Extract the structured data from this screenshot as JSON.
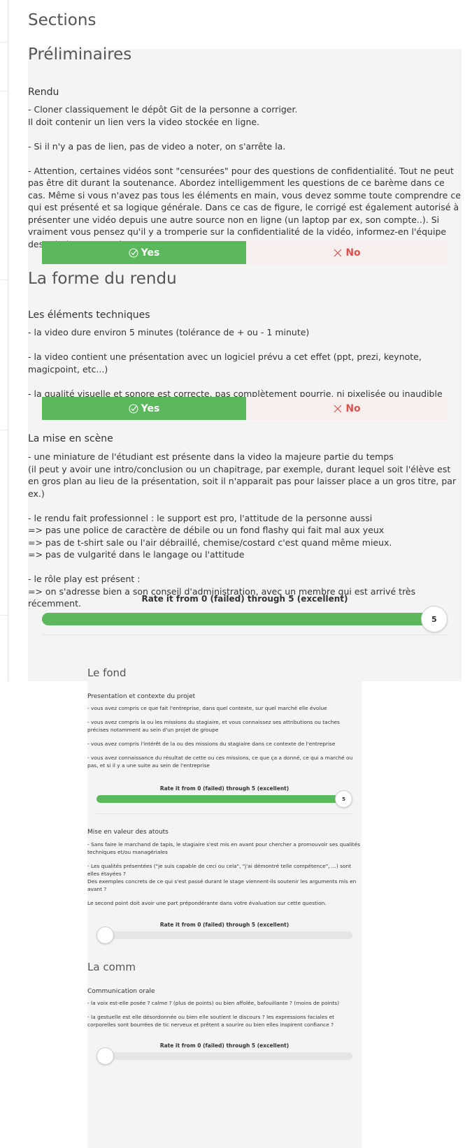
{
  "page": {
    "heading": "Sections"
  },
  "sections": {
    "preliminaires": {
      "title": "Préliminaires",
      "rendu": {
        "title": "Rendu",
        "paragraphs": [
          [
            "- Cloner classiquement le dépôt Git de la personne a corriger.",
            "Il doit contenir un lien vers la video stockée en ligne."
          ],
          [
            "- Si il n'y a pas de lien, pas de video a noter, on s'arrête la."
          ],
          [
            "- Attention, certaines vidéos sont \"censurées\" pour des questions de confidentialité. Tout ne peut pas être dit durant la soutenance. Abordez intelligemment les questions de ce barème dans ce cas. Même si vous n'avez pas tous les éléments en main, vous devez somme toute comprendre ce qui est présenté et sa logique générale. Dans ce cas de figure, le corrigé est également autorisé à présenter une vidéo depuis une autre source non en ligne (un laptop par ex, son compte..). Si vraiment vous pensez qu'il y a tromperie sur la confidentialité de la vidéo, informez-en l'équipe des relations entreprises."
          ]
        ],
        "yes_label": "Yes",
        "no_label": "No"
      }
    },
    "forme": {
      "title": "La forme du rendu",
      "techniques": {
        "title": "Les éléments techniques",
        "paragraphs": [
          [
            "- la video dure environ 5 minutes (tolérance de + ou - 1 minute)"
          ],
          [
            "- la video contient une présentation avec un logiciel prévu a cet effet (ppt, prezi, keynote, magicpoint, etc...)"
          ],
          [
            "- la qualité visuelle et sonore est correcte, pas complètement pourrie, ni pixelisée ou inaudible"
          ]
        ],
        "yes_label": "Yes",
        "no_label": "No"
      },
      "mise_en_scene": {
        "title": "La mise en scène",
        "paragraphs": [
          [
            "- une miniature de l'étudiant est présente dans la video la majeure partie du temps",
            "(il peut y avoir une intro/conclusion ou un chapitrage, par exemple, durant lequel soit l'élève est en gros plan au lieu de la présentation, soit il n'apparait pas pour laisser place a un gros titre, par ex.)"
          ],
          [
            "- le rendu fait professionnel : le support est pro, l'attitude de la personne aussi",
            "=> pas une police de caractère de débile ou un fond flashy qui fait mal aux yeux",
            "=> pas de t-shirt sale ou l'air débraillé, chemise/costard c'est quand même mieux.",
            "=> pas de vulgarité dans le langage ou l'attitude"
          ],
          [
            "- le rôle play est présent :",
            "=> on s'adresse bien a son conseil d'administration, avec un membre qui est arrivé très récemment."
          ]
        ],
        "rate_label": "Rate it from 0 (failed) through 5 (excellent)",
        "rating": 5,
        "rating_max": 5,
        "rating_text": "5"
      }
    },
    "fond": {
      "title": "Le fond",
      "presentation": {
        "title": "Presentation et contexte du projet",
        "paragraphs": [
          [
            "- vous avez compris ce que fait l'entreprise, dans quel contexte, sur quel marché elle évolue"
          ],
          [
            "- vous avez compris la ou les missions du stagiaire, et vous connaissez ses attributions ou taches précises notamment au sein d'un projet de groupe"
          ],
          [
            "- vous avez compris l'intérêt de la ou des missions du stagiaire dans ce contexte de l'entreprise"
          ],
          [
            "- vous avez connaissance du résultat de cette ou ces missions, ce que ça a donné, ce qui a marché ou pas, et si il y a une suite au sein de l'entreprise"
          ]
        ],
        "rate_label": "Rate it from 0 (failed) through 5 (excellent)",
        "rating": 5,
        "rating_max": 5,
        "rating_text": "5"
      },
      "atouts": {
        "title": "Mise en valeur des atouts",
        "paragraphs": [
          [
            "- Sans faire le marchand de tapis, le stagiaire s'est mis en avant pour chercher a promouvoir ses qualités techniques et/ou managériales"
          ],
          [
            "- Les qualités présentées (\"je suis capable de ceci ou cela\", \"j'ai démontré telle compétence\", ...) sont elles étayées ?",
            "Des exemples concrets de ce qui s'est passé durant le stage viennent-ils soutenir les arguments mis en avant ?"
          ],
          [
            "Le second point doit avoir une part prépondérante dans votre évaluation sur cette question."
          ]
        ],
        "rate_label": "Rate it from 0 (failed) through 5 (excellent)",
        "rating": 0,
        "rating_max": 5,
        "rating_text": ""
      }
    },
    "comm": {
      "title": "La comm",
      "orale": {
        "title": "Communication orale",
        "paragraphs": [
          [
            "- la voix est-elle posée ? calme ? (plus de points) ou bien affolée, bafouillante ? (moins de points)"
          ],
          [
            "- la gestuelle est elle désordonnée ou bien elle soutient le discours ? les expressions faciales et corporelles sont bourrées de tic nerveux et prêtent a sourire ou bien elles inspirent confiance ?"
          ]
        ],
        "rate_label": "Rate it from 0 (failed) through 5 (excellent)",
        "rating": 0,
        "rating_max": 5,
        "rating_text": ""
      }
    }
  },
  "colors": {
    "yes": "#5cb85c",
    "no": "#d9534f",
    "panel": "#f4f4f4"
  },
  "icons": {
    "yes": "check-icon",
    "no": "close-icon"
  }
}
